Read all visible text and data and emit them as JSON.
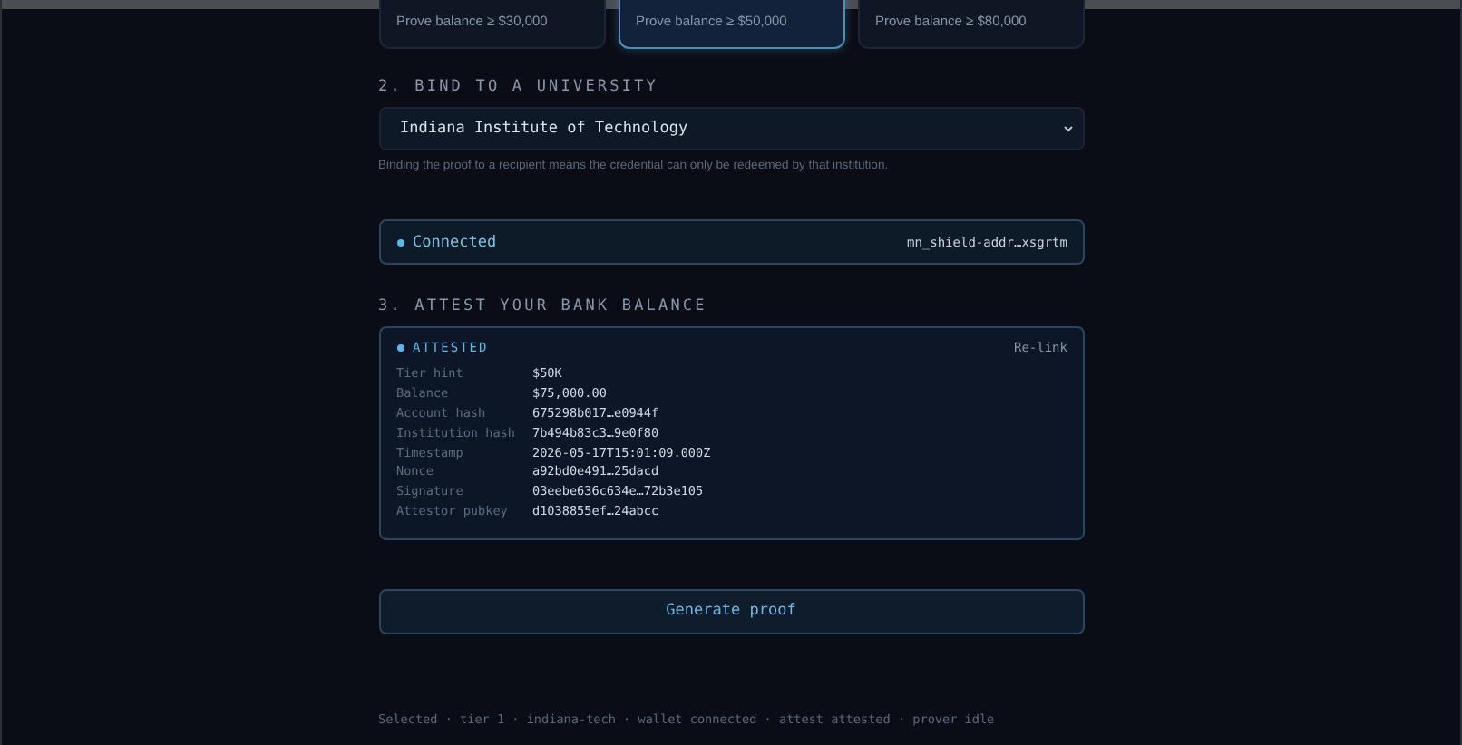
{
  "tiers": [
    {
      "description": "Prove balance ≥ $30,000",
      "selected": false
    },
    {
      "description": "Prove balance ≥ $50,000",
      "selected": true
    },
    {
      "description": "Prove balance ≥ $80,000",
      "selected": false
    }
  ],
  "bind": {
    "heading": "2. BIND TO A UNIVERSITY",
    "value": "Indiana Institute of Technology",
    "hint": "Binding the proof to a recipient means the credential can only be redeemed by that institution."
  },
  "wallet": {
    "status": "Connected",
    "connected": true,
    "address": "mn_shield-addr…xsgrtm"
  },
  "attest": {
    "heading": "3. ATTEST YOUR BANK BALANCE",
    "status": "ATTESTED",
    "action": "Re-link",
    "rows": [
      {
        "label": "Tier hint",
        "value": "$50K"
      },
      {
        "label": "Balance",
        "value": "$75,000.00"
      },
      {
        "label": "Account hash",
        "value": "675298b017…e0944f"
      },
      {
        "label": "Institution hash",
        "value": "7b494b83c3…9e0f80"
      },
      {
        "label": "Timestamp",
        "value": "2026-05-17T15:01:09.000Z"
      },
      {
        "label": "Nonce",
        "value": "a92bd0e491…25dacd"
      },
      {
        "label": "Signature",
        "value": "03eebe636c634e…72b3e105"
      },
      {
        "label": "Attestor pubkey",
        "value": "d1038855ef…24abcc"
      }
    ]
  },
  "generate_button": "Generate proof",
  "footer": "Selected · tier 1 · indiana-tech · wallet connected · attest attested · prover idle"
}
